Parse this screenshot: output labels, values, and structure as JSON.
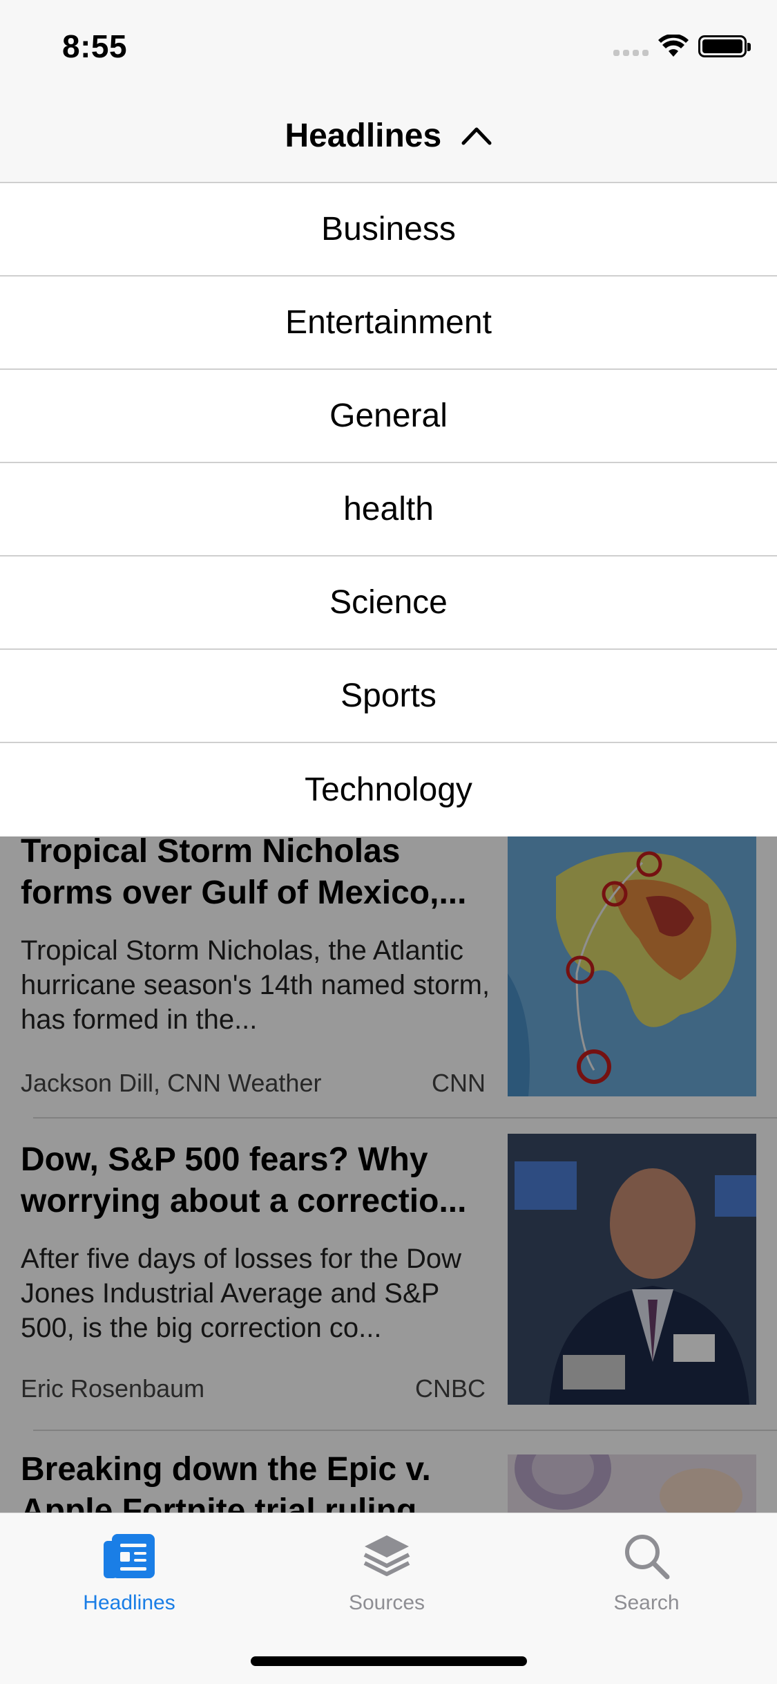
{
  "status_bar": {
    "time": "8:55"
  },
  "nav": {
    "title": "Headlines"
  },
  "dropdown": {
    "items": [
      "Business",
      "Entertainment",
      "General",
      "health",
      "Science",
      "Sports",
      "Technology"
    ]
  },
  "articles": [
    {
      "title": "Tropical Storm Nicholas forms over Gulf of Mexico,...",
      "description": "Tropical Storm Nicholas, the Atlantic hurricane season's 14th named storm, has formed in the...",
      "author": "Jackson Dill, CNN Weather",
      "source": "CNN"
    },
    {
      "title": "Dow, S&P 500 fears? Why worrying about a correctio...",
      "description": "After five days of losses for the Dow Jones Industrial Average and S&P 500, is the big correction co...",
      "author": "Eric Rosenbaum",
      "source": "CNBC"
    },
    {
      "title": "Breaking down the Epic v. Apple Fortnite trial ruling"
    }
  ],
  "tabbar": {
    "tabs": [
      {
        "label": "Headlines",
        "icon": "newspaper-icon",
        "active": true
      },
      {
        "label": "Sources",
        "icon": "layers-icon",
        "active": false
      },
      {
        "label": "Search",
        "icon": "search-icon",
        "active": false
      }
    ]
  },
  "colors": {
    "accent": "#1a7ee6",
    "inactive": "#8e8e93"
  }
}
